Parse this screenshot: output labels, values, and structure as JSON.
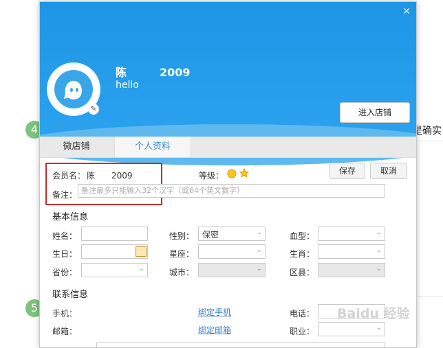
{
  "background": {
    "step_4": "4",
    "step_5": "5",
    "right_text": "是确实"
  },
  "dialog": {
    "close_glyph": "✕",
    "user": {
      "name": "陈　　　2009",
      "signature": "hello"
    },
    "enter_shop_label": "进入店铺",
    "tabs": [
      {
        "label": "微店铺",
        "active": false
      },
      {
        "label": "个人资料",
        "active": true
      }
    ],
    "profile": {
      "member_label": "会员名：",
      "member_value": "陈　　2009",
      "level_label": "等级：",
      "remark_label": "备注：",
      "remark_placeholder": "备注最多只能输入32个汉字（或64个英文数字）",
      "save_label": "保存",
      "cancel_label": "取消"
    },
    "basic_info": {
      "title": "基本信息",
      "name_label": "姓名：",
      "gender_label": "性别：",
      "gender_value": "保密",
      "blood_label": "血型：",
      "birthday_label": "生日：",
      "constellation_label": "星座：",
      "zodiac_label": "生肖：",
      "province_label": "省份：",
      "city_label": "城市：",
      "district_label": "区县："
    },
    "contact_info": {
      "title": "联系信息",
      "mobile_label": "手机：",
      "bind_mobile": "绑定手机",
      "phone_label": "电话：",
      "email_label": "邮箱：",
      "bind_email": "绑定邮箱",
      "job_label": "职业："
    }
  },
  "watermark": "Baidu 经验",
  "colors": {
    "header_blue": "#1e96e5",
    "highlight_red": "#cc2a2a",
    "link_blue": "#3b7fc4"
  }
}
